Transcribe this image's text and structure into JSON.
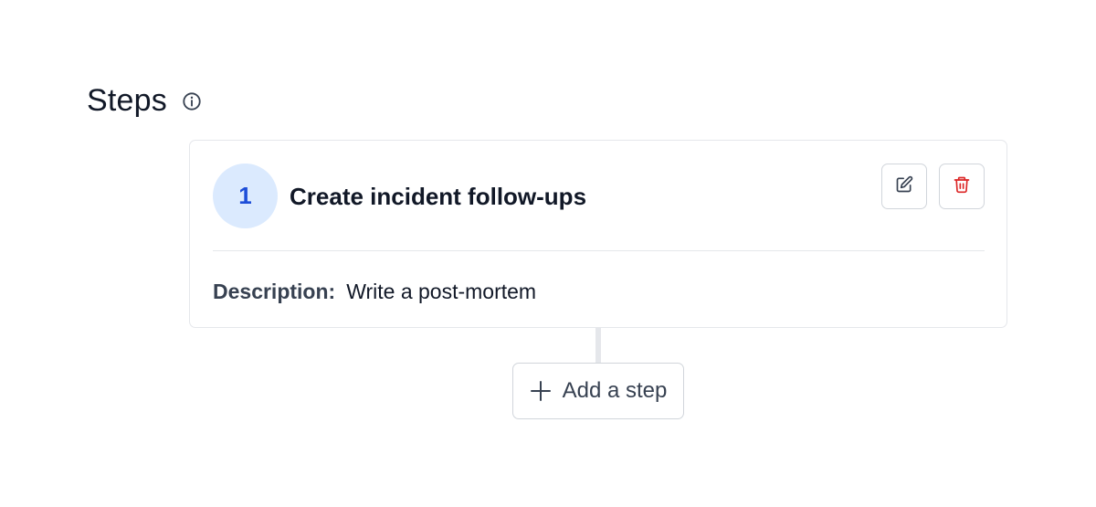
{
  "section": {
    "title": "Steps"
  },
  "steps": [
    {
      "number": "1",
      "title": "Create incident follow-ups",
      "description_label": "Description:",
      "description_value": "Write a post-mortem"
    }
  ],
  "add_step": {
    "label": "Add a step"
  },
  "icons": {
    "info": "info-icon",
    "edit": "edit-icon",
    "delete": "trash-icon",
    "add": "plus-icon"
  },
  "colors": {
    "accent": "#1d4ed8",
    "step_badge_bg": "#dbeafe",
    "danger": "#dc2626",
    "border": "#e5e7eb"
  }
}
